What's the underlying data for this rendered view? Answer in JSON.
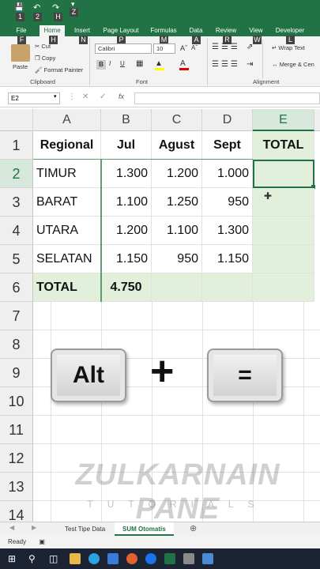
{
  "qat": {
    "num1": "1",
    "num2": "2",
    "h": "H",
    "z": "Z"
  },
  "tabs": [
    {
      "label": "File",
      "key": "F"
    },
    {
      "label": "Home",
      "key": "H"
    },
    {
      "label": "Insert",
      "key": "N"
    },
    {
      "label": "Page Layout",
      "key": "P"
    },
    {
      "label": "Formulas",
      "key": "M"
    },
    {
      "label": "Data",
      "key": "A"
    },
    {
      "label": "Review",
      "key": "R"
    },
    {
      "label": "View",
      "key": "W"
    },
    {
      "label": "Developer",
      "key": "L"
    }
  ],
  "ribbon": {
    "paste": "Paste",
    "cut": "Cut",
    "copy": "Copy",
    "format_painter": "Format Painter",
    "clipboard": "Clipboard",
    "font_name": "Calibri",
    "font_size": "10",
    "font": "Font",
    "wrap_text": "Wrap Text",
    "merge": "Merge & Cen",
    "alignment": "Alignment",
    "bold": "B",
    "italic": "I",
    "underline": "U"
  },
  "name_box": "E2",
  "formula_fx": "fx",
  "columns": [
    "A",
    "B",
    "C",
    "D",
    "E"
  ],
  "rows": [
    "1",
    "2",
    "3",
    "4",
    "5",
    "6",
    "7",
    "8",
    "9",
    "10",
    "11",
    "12",
    "13",
    "14"
  ],
  "table": {
    "headers": [
      "Regional",
      "Jul",
      "Agust",
      "Sept",
      "TOTAL"
    ],
    "data": [
      [
        "TIMUR",
        "1.300",
        "1.200",
        "1.000"
      ],
      [
        "BARAT",
        "1.100",
        "1.250",
        "950"
      ],
      [
        "UTARA",
        "1.200",
        "1.100",
        "1.300"
      ],
      [
        "SELATAN",
        "1.150",
        "950",
        "1.150"
      ]
    ],
    "total_label": "TOTAL",
    "total_jul": "4.750"
  },
  "overlay": {
    "alt_key": "Alt",
    "plus": "+",
    "eq_key": "="
  },
  "watermark": {
    "line1": "ZULKARNAIN PANE",
    "line2": "TUTORIALS"
  },
  "sheets": [
    "Test Tipe Data",
    "SUM Otomatis"
  ],
  "status": "Ready",
  "colors": {
    "excel_green": "#217346",
    "highlight": "#e2efda"
  }
}
